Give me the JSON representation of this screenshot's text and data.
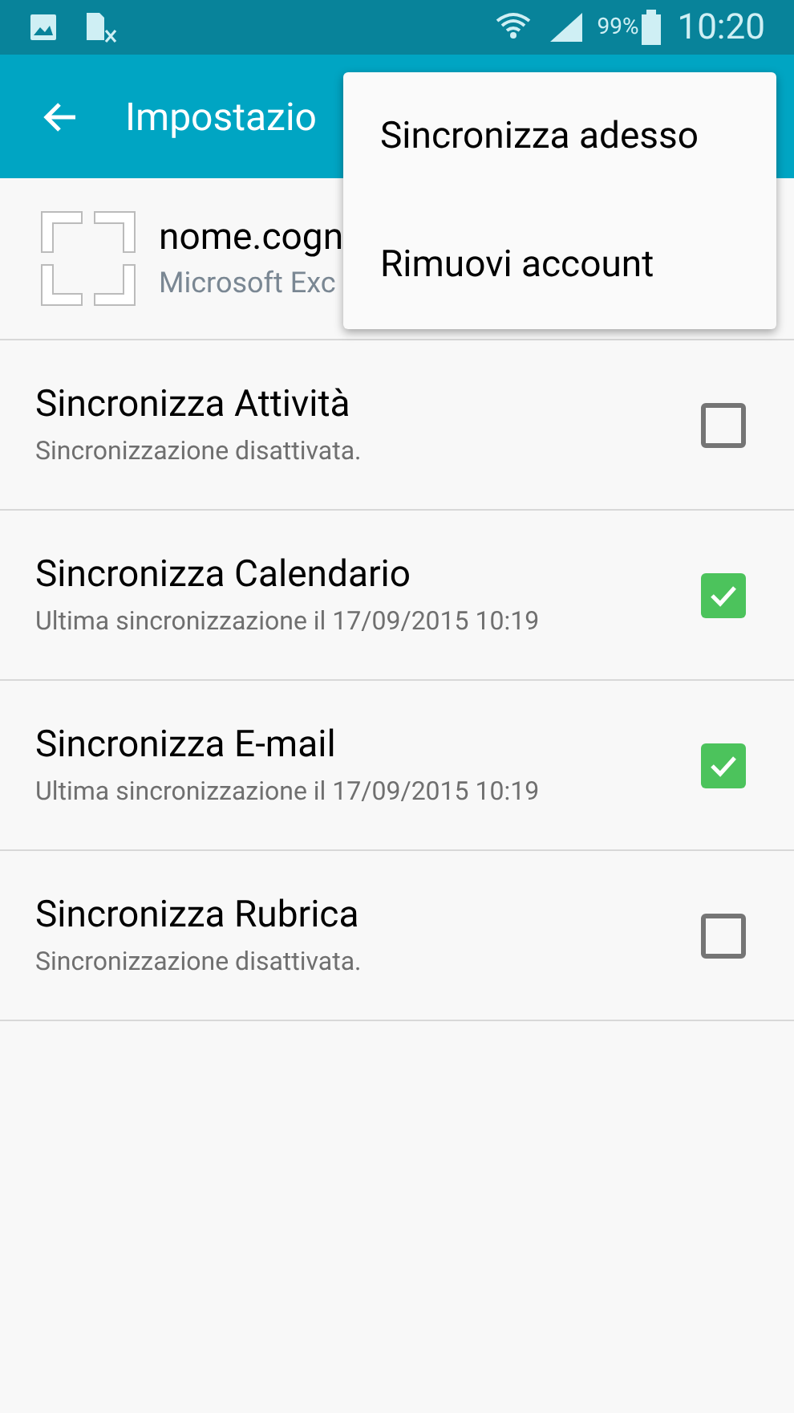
{
  "status_bar": {
    "battery": "99%",
    "time": "10:20"
  },
  "app_bar": {
    "title": "Impostazio"
  },
  "account": {
    "name": "nome.cogn",
    "type": "Microsoft Exc"
  },
  "sync_items": [
    {
      "title": "Sincronizza Attività",
      "subtitle": "Sincronizzazione disattivata.",
      "checked": false
    },
    {
      "title": "Sincronizza Calendario",
      "subtitle": "Ultima sincronizzazione il 17/09/2015 10:19",
      "checked": true
    },
    {
      "title": "Sincronizza E-mail",
      "subtitle": "Ultima sincronizzazione il 17/09/2015 10:19",
      "checked": true
    },
    {
      "title": "Sincronizza Rubrica",
      "subtitle": "Sincronizzazione disattivata.",
      "checked": false
    }
  ],
  "menu": {
    "items": [
      "Sincronizza adesso",
      "Rimuovi account"
    ]
  }
}
